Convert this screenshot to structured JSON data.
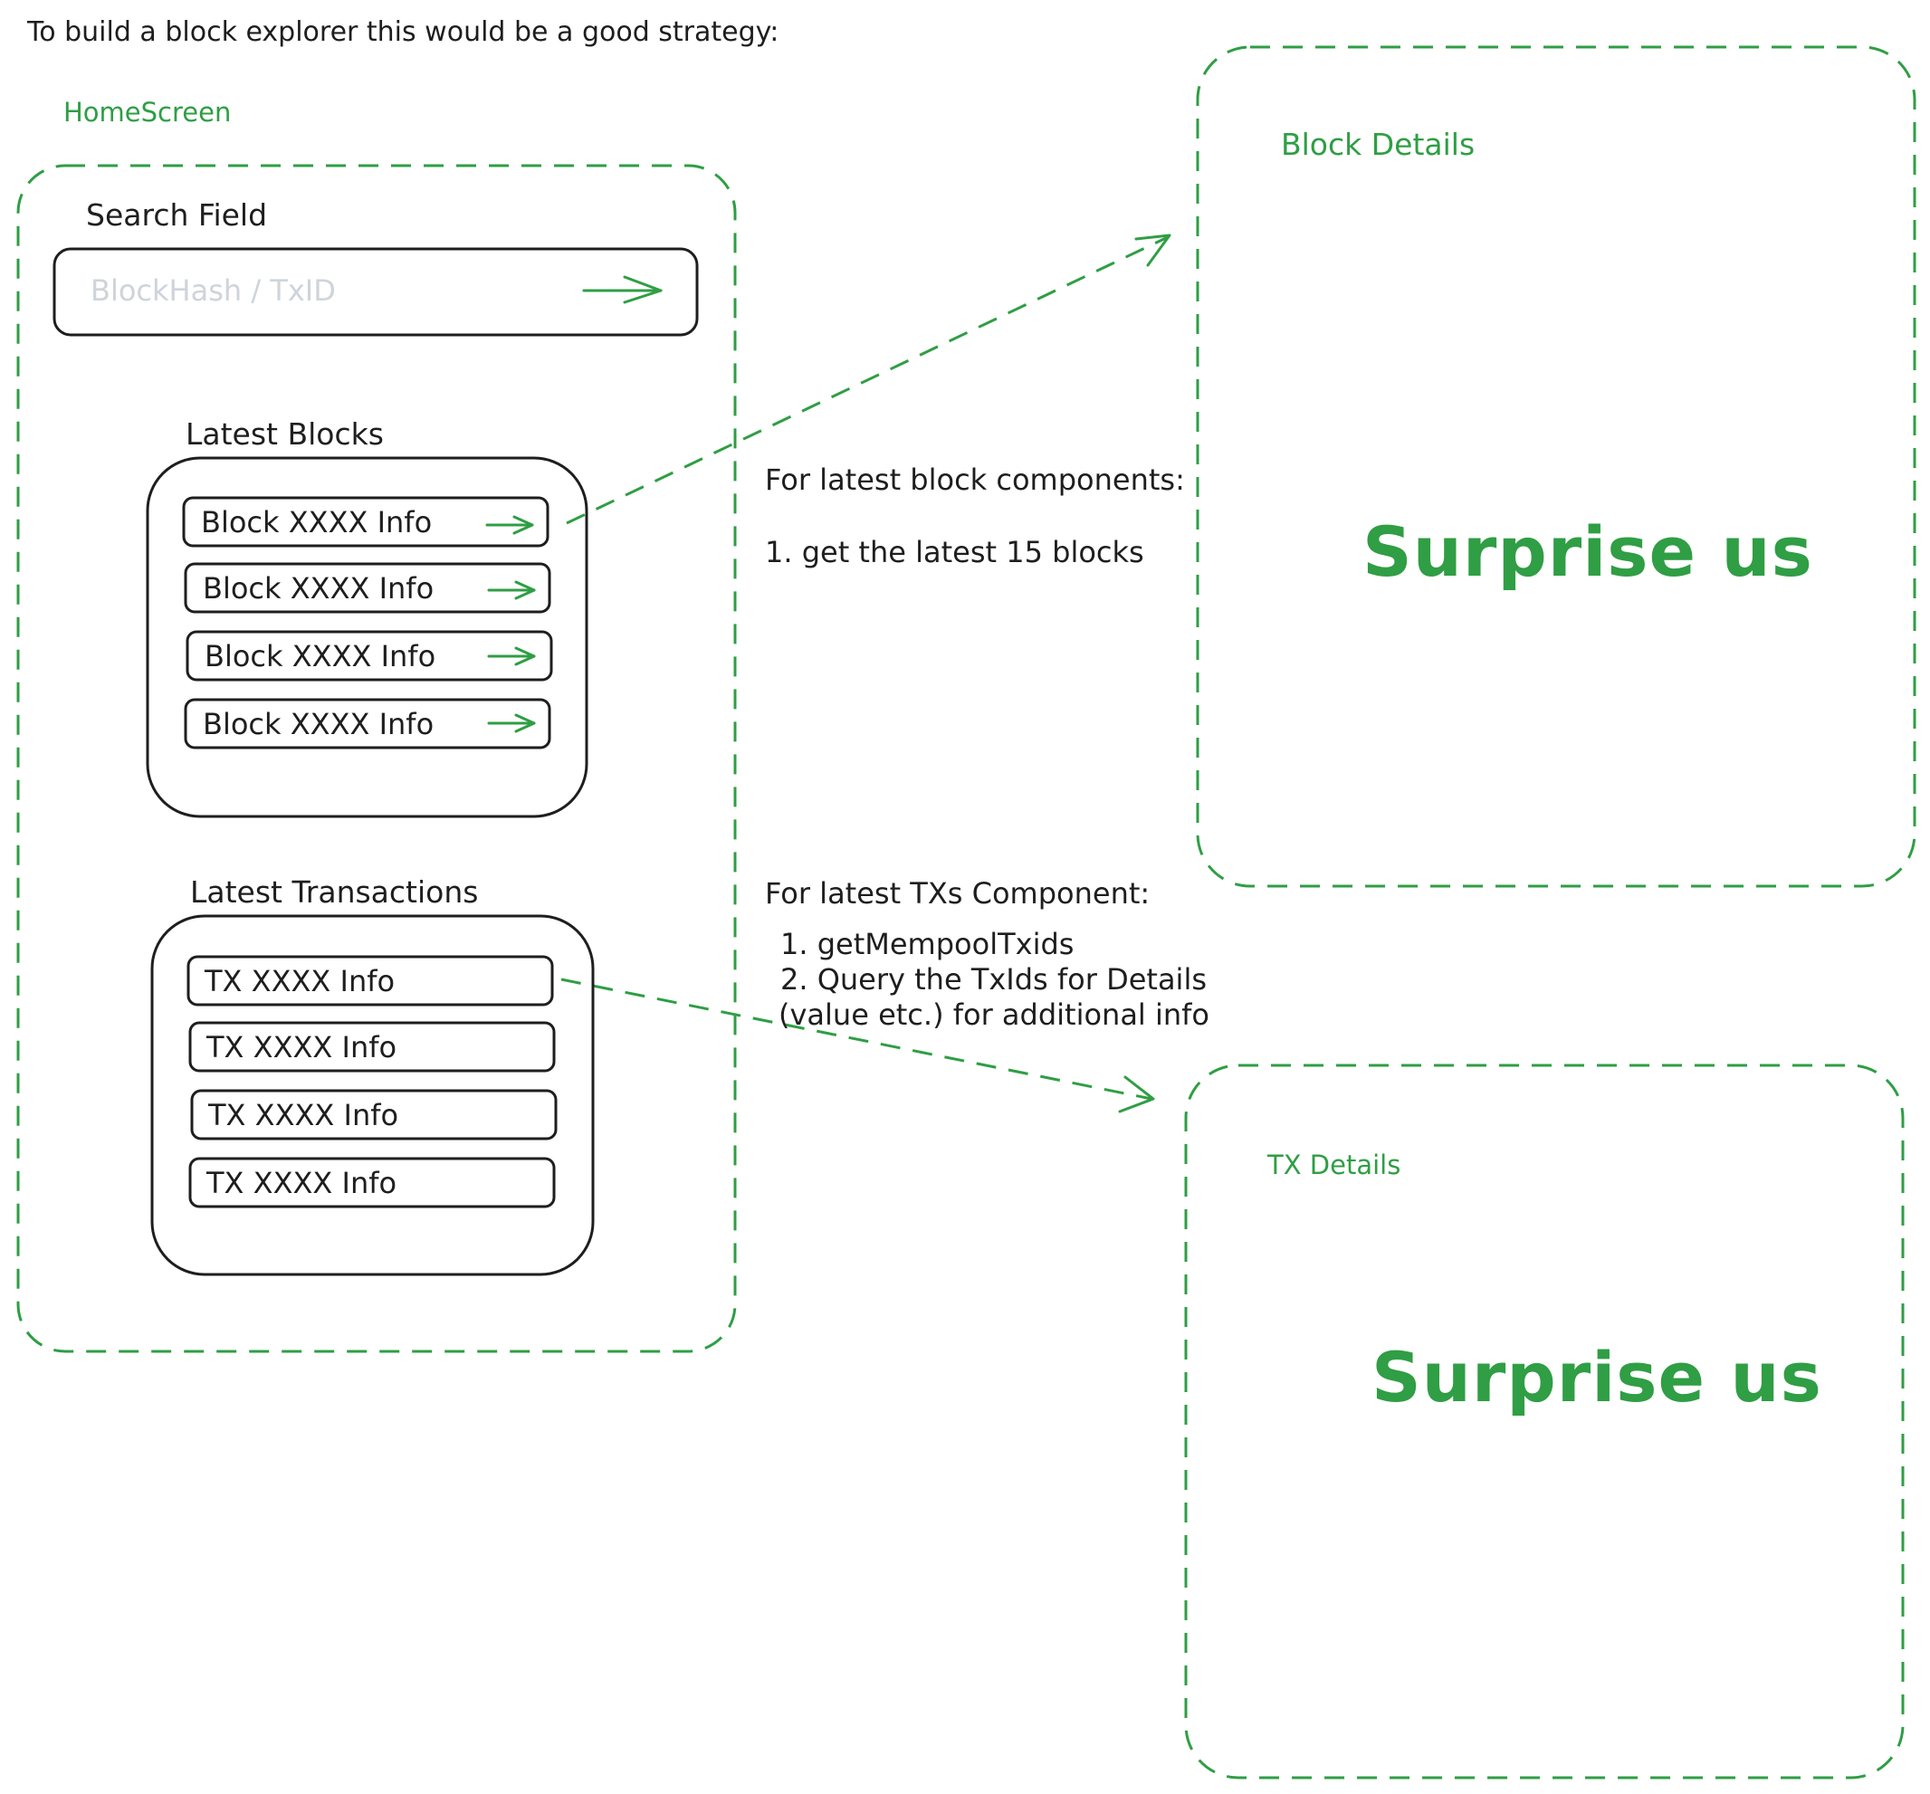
{
  "intro": "To build a block explorer this would be a good strategy:",
  "home": {
    "label": "HomeScreen",
    "search": {
      "label": "Search Field",
      "placeholder": "BlockHash / TxID",
      "submit_icon": "arrow-right-icon"
    },
    "latest_blocks": {
      "label": "Latest Blocks",
      "items": [
        "Block XXXX Info",
        "Block XXXX Info",
        "Block XXXX Info",
        "Block XXXX Info"
      ],
      "item_icon": "arrow-right-icon"
    },
    "latest_transactions": {
      "label": "Latest Transactions",
      "items": [
        "TX XXXX Info",
        "TX XXXX Info",
        "TX XXXX Info",
        "TX XXXX Info"
      ]
    }
  },
  "notes": {
    "blocks": {
      "title": "For latest block components:",
      "step1": "1. get the latest 15 blocks"
    },
    "txs": {
      "title": "For latest TXs Component:",
      "step1": "1. getMempoolTxids",
      "step2": "2. Query the TxIds for Details",
      "step2_cont": "(value etc.) for additional info"
    }
  },
  "block_details": {
    "label": "Block Details",
    "content": "Surprise us"
  },
  "tx_details": {
    "label": "TX Details",
    "content": "Surprise us"
  },
  "colors": {
    "accent": "#2f9e44",
    "stroke": "#1e1e1e",
    "placeholder": "#ced4da"
  }
}
